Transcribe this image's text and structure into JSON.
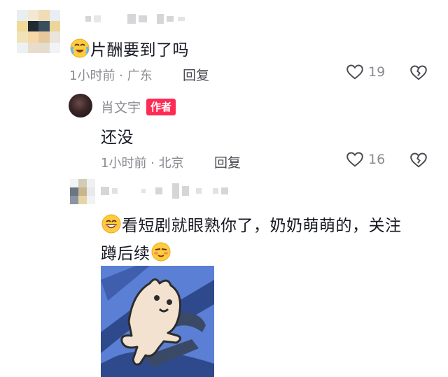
{
  "comments": [
    {
      "text": "片酬要到了吗",
      "time": "1小时前 · 广东",
      "reply_label": "回复",
      "likes": "19"
    },
    {
      "author": "肖文宇",
      "author_badge": "作者",
      "text": "还没",
      "time": "1小时前 · 北京",
      "reply_label": "回复",
      "likes": "16"
    },
    {
      "text_line1": "看短剧就眼熟你了，奶奶萌萌的，关注",
      "text_line2": "蹲后续"
    }
  ],
  "icons": {
    "like": "heart-outline-icon",
    "dislike": "broken-heart-icon",
    "emoji_cry": "crying-laughing-emoji",
    "emoji_grin": "grinning-emoji",
    "emoji_sly": "blush-emoji"
  },
  "colors": {
    "badge": "#fe2c55",
    "meta": "#8a8b91",
    "text": "#161823"
  }
}
